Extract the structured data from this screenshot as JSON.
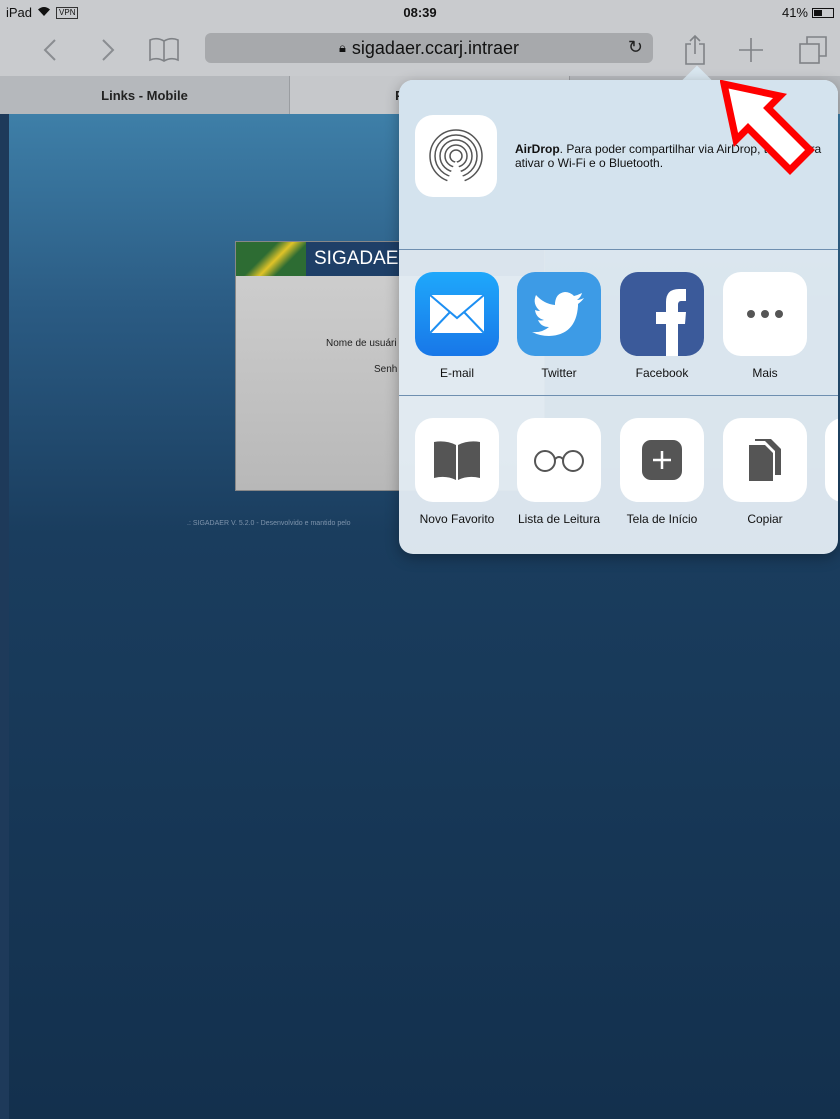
{
  "status": {
    "device": "iPad",
    "vpn": "VPN",
    "time": "08:39",
    "battery": "41%"
  },
  "toolbar": {
    "url": "sigadaer.ccarj.intraer"
  },
  "tabs": [
    "Links - Mobile",
    "Página Inic"
  ],
  "page": {
    "app_name": "SIGADAE",
    "username_label": "Nome de usuári",
    "password_label": "Senh",
    "footer": ".: SIGADAER V. 5.2.0 - Desenvolvido e mantido pelo"
  },
  "share": {
    "airdrop_title": "AirDrop",
    "airdrop_text": ". Para poder compartilhar via AirDrop, toque para ativar o Wi-Fi e o Bluetooth.",
    "apps": [
      {
        "label": "E-mail",
        "icon": "mail-icon",
        "color": "#1d8ff2"
      },
      {
        "label": "Twitter",
        "icon": "twitter-icon",
        "color": "#3d9be6"
      },
      {
        "label": "Facebook",
        "icon": "facebook-icon",
        "color": "#3b5a9a"
      },
      {
        "label": "Mais",
        "icon": "more-icon",
        "color": "#ffffff"
      }
    ],
    "actions": [
      {
        "label": "Novo Favorito",
        "icon": "bookmark-icon"
      },
      {
        "label": "Lista de Leitura",
        "icon": "reading-list-icon"
      },
      {
        "label": "Tela de Início",
        "icon": "add-home-icon"
      },
      {
        "label": "Copiar",
        "icon": "copy-icon"
      }
    ]
  }
}
